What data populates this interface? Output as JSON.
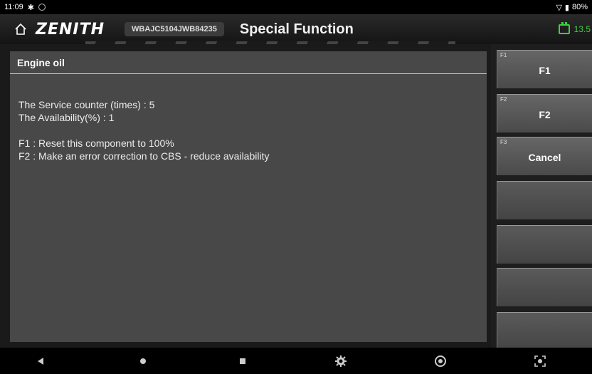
{
  "status_bar": {
    "time": "11:09",
    "battery": "80%"
  },
  "header": {
    "brand": "ZENITH",
    "vin": "WBAJC5104JWB84235",
    "title": "Special Function",
    "voltage": "13.5",
    "accent_color": "#3fcf3f"
  },
  "panel": {
    "title": "Engine oil",
    "lines": [
      "The Service counter (times) :    5",
      "The Availability(%) :    1",
      "F1 : Reset this component to 100%",
      "F2 : Make an error correction to CBS - reduce availability"
    ]
  },
  "function_keys": [
    {
      "key": "F1",
      "label": "F1"
    },
    {
      "key": "F2",
      "label": "F2"
    },
    {
      "key": "F3",
      "label": "Cancel"
    }
  ],
  "nav": {
    "icons": [
      "back-icon",
      "home-icon",
      "recents-icon",
      "settings-icon",
      "browser-icon",
      "screenshot-icon"
    ]
  }
}
